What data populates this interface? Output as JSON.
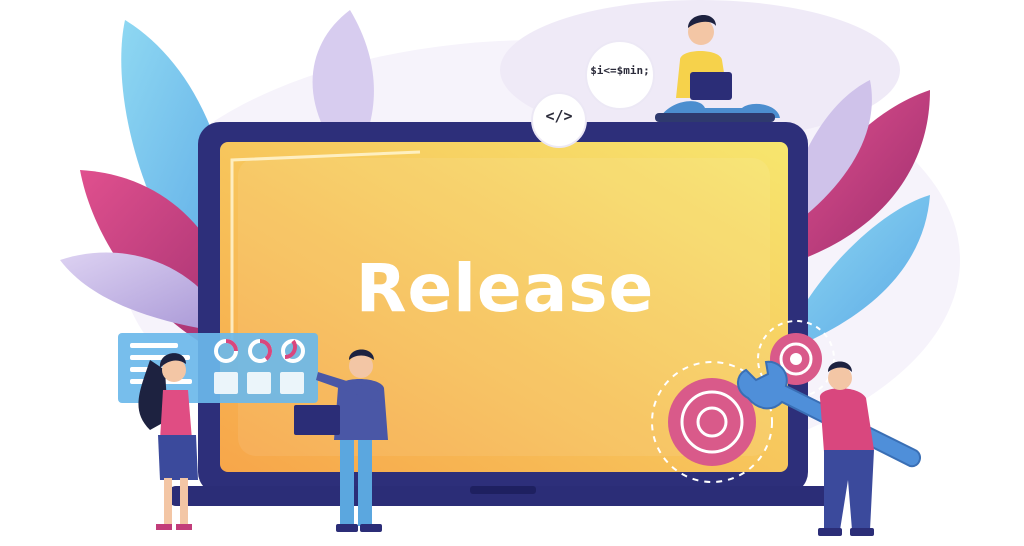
{
  "illustration": {
    "screen_title": "Release",
    "code_tag": "</>",
    "code_line": "$i<=$min;",
    "icons": [
      "leaf-decoration",
      "laptop-screen",
      "dashboard-panel",
      "gear-icon",
      "wrench-icon",
      "code-bubble"
    ],
    "colors": {
      "leaf_blue": "#6ec6ee",
      "leaf_pink": "#c03a7a",
      "leaf_lilac": "#b9a7de",
      "laptop_frame": "#2d2f7a",
      "screen_start": "#f7b04a",
      "screen_end": "#f6e06a",
      "gear_pink": "#d95a8a",
      "wrench_blue": "#4f8fd9"
    }
  }
}
